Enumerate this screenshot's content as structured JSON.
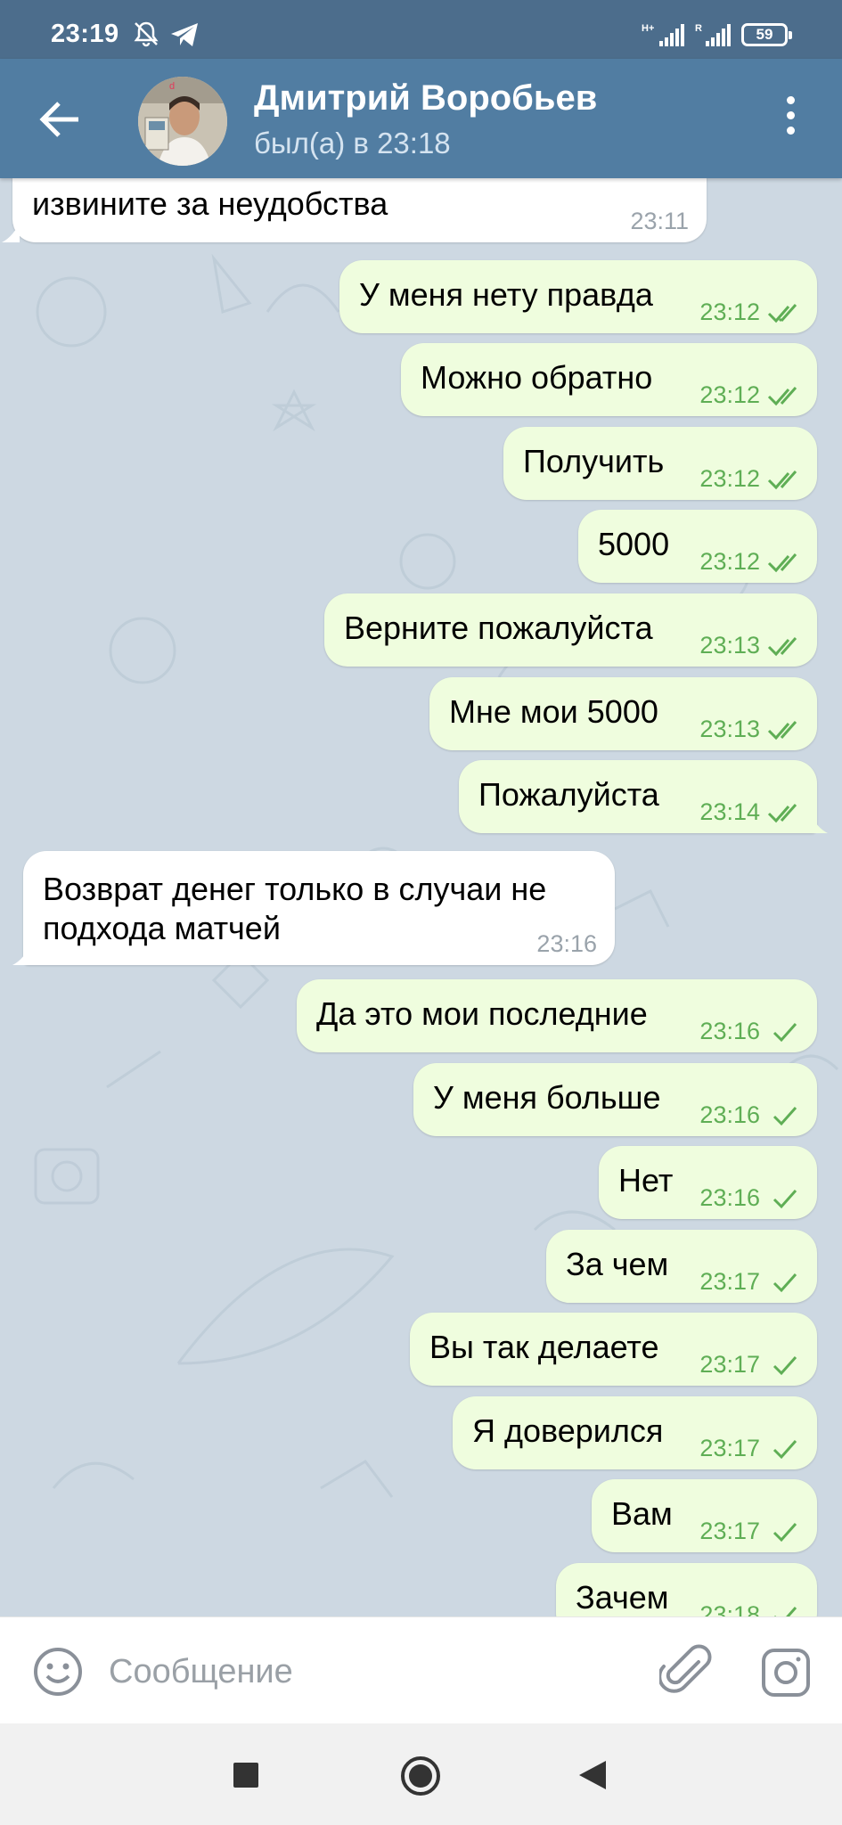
{
  "status_bar": {
    "time": "23:19",
    "battery": "59"
  },
  "header": {
    "contact_name": "Дмитрий Воробьев",
    "contact_status": "был(а) в 23:18"
  },
  "messages": [
    {
      "dir": "in",
      "text": "извините за неудобства",
      "time": "23:11"
    },
    {
      "dir": "out",
      "text": "У меня нету правда",
      "time": "23:12",
      "status": "read"
    },
    {
      "dir": "out",
      "text": "Можно обратно",
      "time": "23:12",
      "status": "read"
    },
    {
      "dir": "out",
      "text": "Получить",
      "time": "23:12",
      "status": "read"
    },
    {
      "dir": "out",
      "text": "5000",
      "time": "23:12",
      "status": "read"
    },
    {
      "dir": "out",
      "text": "Верните пожалуйста",
      "time": "23:13",
      "status": "read"
    },
    {
      "dir": "out",
      "text": "Мне мои 5000",
      "time": "23:13",
      "status": "read"
    },
    {
      "dir": "out",
      "text": "Пожалуйста",
      "time": "23:14",
      "status": "read"
    },
    {
      "dir": "in",
      "text_line1": "Возврат денег только в случаи не",
      "text_line2": "подхода матчей",
      "time": "23:16"
    },
    {
      "dir": "out",
      "text": "Да это мои последние",
      "time": "23:16",
      "status": "sent"
    },
    {
      "dir": "out",
      "text": "У меня больше",
      "time": "23:16",
      "status": "sent"
    },
    {
      "dir": "out",
      "text": "Нет",
      "time": "23:16",
      "status": "sent"
    },
    {
      "dir": "out",
      "text": "За чем",
      "time": "23:17",
      "status": "sent"
    },
    {
      "dir": "out",
      "text": "Вы так делаете",
      "time": "23:17",
      "status": "sent"
    },
    {
      "dir": "out",
      "text": "Я доверился",
      "time": "23:17",
      "status": "sent"
    },
    {
      "dir": "out",
      "text": "Вам",
      "time": "23:17",
      "status": "sent"
    },
    {
      "dir": "out",
      "text": "Зачем",
      "time": "23:18",
      "status": "sent"
    }
  ],
  "input": {
    "placeholder": "Сообщение"
  },
  "colors": {
    "header": "#517da2",
    "status_bar": "#4c6d8c",
    "outgoing_bubble": "#effdde",
    "incoming_bubble": "#ffffff",
    "check_color": "#5fae55"
  },
  "icons": {
    "back": "arrow-left-icon",
    "menu": "more-vertical-icon",
    "emoji": "smile-icon",
    "attach": "paperclip-icon",
    "camera": "camera-icon",
    "read": "double-check-icon",
    "sent": "single-check-icon"
  }
}
